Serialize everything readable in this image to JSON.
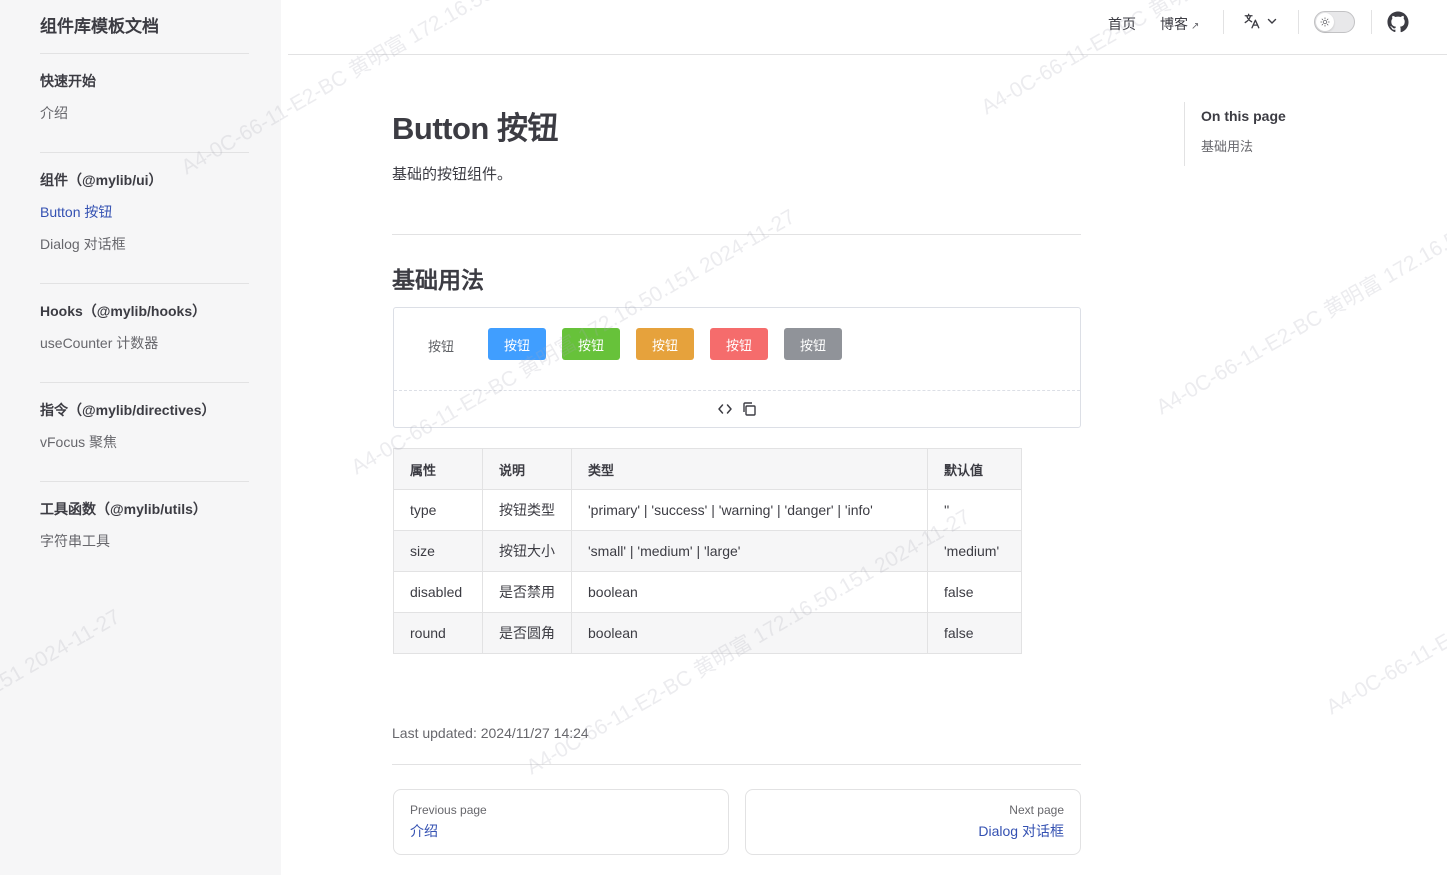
{
  "sidebar": {
    "site_title": "组件库模板文档",
    "groups": [
      {
        "title": "快速开始",
        "items": [
          {
            "label": "介绍"
          }
        ]
      },
      {
        "title": "组件（@mylib/ui）",
        "items": [
          {
            "label": "Button 按钮"
          },
          {
            "label": "Dialog 对话框"
          }
        ]
      },
      {
        "title": "Hooks（@mylib/hooks）",
        "items": [
          {
            "label": "useCounter 计数器"
          }
        ]
      },
      {
        "title": "指令（@mylib/directives）",
        "items": [
          {
            "label": "vFocus 聚焦"
          }
        ]
      },
      {
        "title": "工具函数（@mylib/utils）",
        "items": [
          {
            "label": "字符串工具"
          }
        ]
      }
    ]
  },
  "nav": {
    "home": "首页",
    "blog": "博客",
    "blog_ext_icon": "↗"
  },
  "content": {
    "title": "Button 按钮",
    "description": "基础的按钮组件。",
    "section_title": "基础用法",
    "demo": {
      "label": "按钮",
      "buttons": [
        {
          "label": "按钮",
          "color": "#409eff"
        },
        {
          "label": "按钮",
          "color": "#67c23a"
        },
        {
          "label": "按钮",
          "color": "#e6a23c"
        },
        {
          "label": "按钮",
          "color": "#f56c6c"
        },
        {
          "label": "按钮",
          "color": "#909399"
        }
      ]
    },
    "table": {
      "headers": [
        "属性",
        "说明",
        "类型",
        "默认值"
      ],
      "rows": [
        [
          "type",
          "按钮类型",
          "'primary' | 'success' | 'warning' | 'danger' | 'info'",
          "''"
        ],
        [
          "size",
          "按钮大小",
          "'small' | 'medium' | 'large'",
          "'medium'"
        ],
        [
          "disabled",
          "是否禁用",
          "boolean",
          "false"
        ],
        [
          "round",
          "是否圆角",
          "boolean",
          "false"
        ]
      ]
    },
    "last_updated": "Last updated: 2024/11/27 14:24",
    "prev": {
      "desc": "Previous page",
      "title": "介绍"
    },
    "next": {
      "desc": "Next page",
      "title": "Dialog 对话框"
    }
  },
  "outline": {
    "title": "On this page",
    "items": [
      "基础用法"
    ]
  },
  "watermark": "A4-0C-66-11-E2-BC  黄明富  172.16.50.151  2024-11-27",
  "colors": {
    "brand": "#3451b2"
  }
}
